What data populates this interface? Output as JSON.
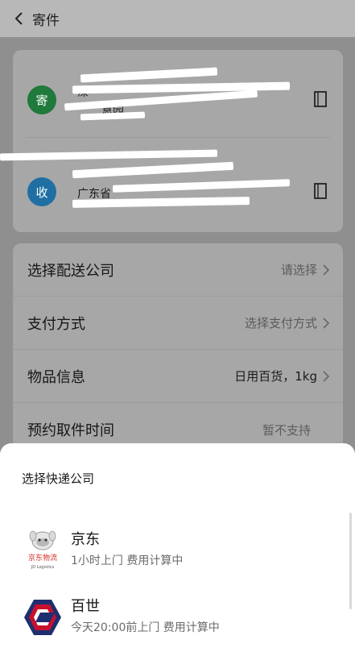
{
  "header": {
    "title": "寄件"
  },
  "addresses": {
    "sender": {
      "badge": "寄",
      "line1": "深",
      "line3": "意园"
    },
    "receiver": {
      "badge": "收",
      "line2": "广东省"
    }
  },
  "options": [
    {
      "label": "选择配送公司",
      "value": "请选择"
    },
    {
      "label": "支付方式",
      "value": "选择支付方式"
    },
    {
      "label": "物品信息",
      "value": "日用百货，1kg"
    },
    {
      "label": "预约取件时间",
      "value": "暂不支持"
    }
  ],
  "sheet": {
    "title": "选择快递公司",
    "carriers": [
      {
        "name": "京东",
        "desc": "1小时上门  费用计算中",
        "logo_text": "京东物流",
        "logo_sub": "JD Logistics"
      },
      {
        "name": "百世",
        "desc": "今天20:00前上门  费用计算中"
      }
    ]
  },
  "colors": {
    "sender": "#1f7a3b",
    "receiver": "#1f6fa3",
    "bestRed": "#c8102e",
    "bestNavy": "#1d2f6f"
  }
}
